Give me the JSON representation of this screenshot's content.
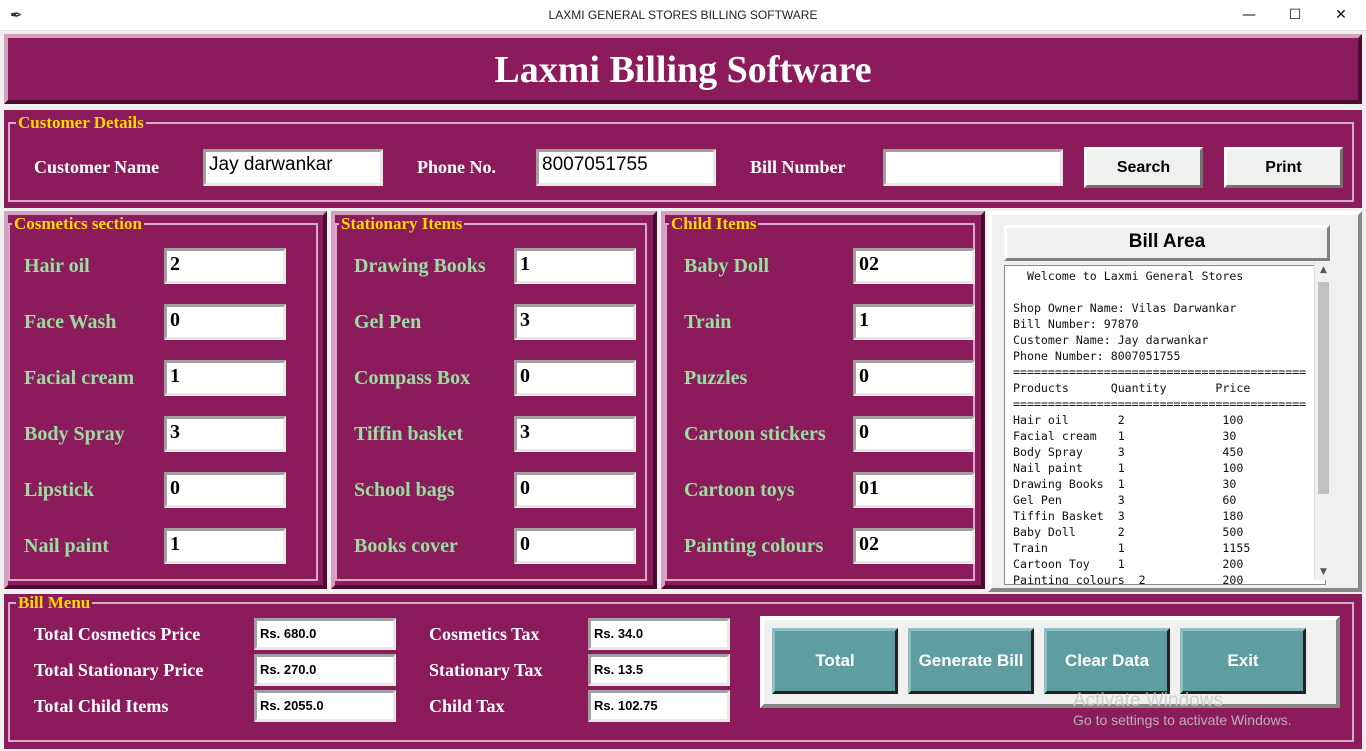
{
  "window": {
    "title": "LAXMI GENERAL STORES BILLING SOFTWARE",
    "app_icon": "feather-icon",
    "controls": {
      "minimize": "—",
      "maximize": "☐",
      "close": "✕"
    }
  },
  "header": {
    "title": "Laxmi Billing Software"
  },
  "customer": {
    "legend": "Customer Details",
    "name_label": "Customer Name",
    "name_value": "Jay darwankar",
    "phone_label": "Phone No.",
    "phone_value": "8007051755",
    "bill_label": "Bill Number",
    "bill_value": "",
    "search_button": "Search",
    "print_button": "Print"
  },
  "cosmetics": {
    "legend": "Cosmetics section",
    "items": [
      {
        "label": "Hair oil",
        "value": "2"
      },
      {
        "label": "Face Wash",
        "value": "0"
      },
      {
        "label": "Facial cream",
        "value": "1"
      },
      {
        "label": "Body Spray",
        "value": "3"
      },
      {
        "label": "Lipstick",
        "value": "0"
      },
      {
        "label": "Nail paint",
        "value": "1"
      }
    ]
  },
  "stationary": {
    "legend": "Stationary Items",
    "items": [
      {
        "label": "Drawing Books",
        "value": "1"
      },
      {
        "label": "Gel Pen",
        "value": "3"
      },
      {
        "label": "Compass Box",
        "value": "0"
      },
      {
        "label": "Tiffin basket",
        "value": "3"
      },
      {
        "label": "School bags",
        "value": "0"
      },
      {
        "label": "Books cover",
        "value": "0"
      }
    ]
  },
  "child": {
    "legend": "Child Items",
    "items": [
      {
        "label": "Baby Doll",
        "value": "02"
      },
      {
        "label": "Train",
        "value": "1"
      },
      {
        "label": "Puzzles",
        "value": "0"
      },
      {
        "label": "Cartoon stickers",
        "value": "0"
      },
      {
        "label": "Cartoon toys",
        "value": "01"
      },
      {
        "label": "Painting colours",
        "value": "02"
      }
    ]
  },
  "bill_area": {
    "title": "Bill Area",
    "lines": [
      "  Welcome to Laxmi General Stores",
      "",
      "Shop Owner Name: Vilas Darwankar",
      "Bill Number: 97870",
      "Customer Name: Jay darwankar",
      "Phone Number: 8007051755",
      "==========================================",
      "Products      Quantity       Price",
      "==========================================",
      "Hair oil       2              100",
      "Facial cream   1              30",
      "Body Spray     3              450",
      "Nail paint     1              100",
      "Drawing Books  1              30",
      "Gel Pen        3              60",
      "Tiffin Basket  3              180",
      "Baby Doll      2              500",
      "Train          1              1155",
      "Cartoon Toy    1              200",
      "Painting colours  2           200"
    ]
  },
  "bill_menu": {
    "legend": "Bill Menu",
    "total_cosmetics_label": "Total Cosmetics Price",
    "total_cosmetics_value": "Rs. 680.0",
    "total_stationary_label": "Total Stationary Price",
    "total_stationary_value": "Rs. 270.0",
    "total_child_label": "Total Child Items",
    "total_child_value": "Rs. 2055.0",
    "cosmetics_tax_label": "Cosmetics Tax",
    "cosmetics_tax_value": "Rs. 34.0",
    "stationary_tax_label": "Stationary Tax",
    "stationary_tax_value": "Rs. 13.5",
    "child_tax_label": "Child Tax",
    "child_tax_value": "Rs. 102.75",
    "buttons": {
      "total": "Total",
      "generate": "Generate Bill",
      "clear": "Clear Data",
      "exit": "Exit"
    }
  },
  "watermark": {
    "line1": "Activate Windows",
    "line2": "Go to settings to activate Windows."
  },
  "colors": {
    "panel": "#8b1b5b",
    "legend": "#ffd700",
    "item_label": "#98e0a0",
    "button_teal": "#5f9ea0"
  }
}
